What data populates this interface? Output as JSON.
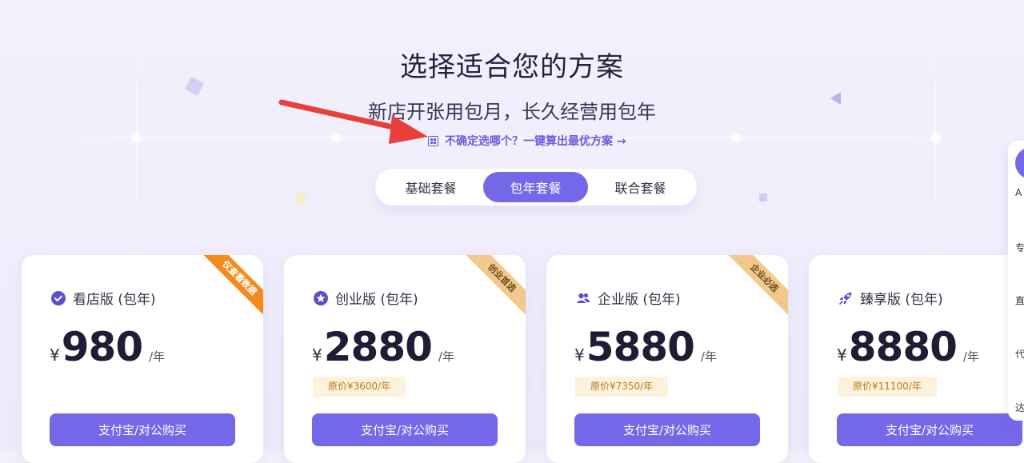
{
  "header": {
    "title": "选择适合您的方案",
    "subtitle": "新店开张用包月，长久经营用包年",
    "calc_link": "不确定选哪个？一键算出最优方案 →"
  },
  "tabs": [
    {
      "label": "基础套餐",
      "active": false
    },
    {
      "label": "包年套餐",
      "active": true
    },
    {
      "label": "联合套餐",
      "active": false
    }
  ],
  "plans": [
    {
      "name": "看店版 (包年)",
      "currency": "¥",
      "price": "980",
      "unit": "/年",
      "original_price": "",
      "ribbon": "仅查看数据",
      "button": "支付宝/对公购买",
      "icon": "check-circle-icon"
    },
    {
      "name": "创业版 (包年)",
      "currency": "¥",
      "price": "2880",
      "unit": "/年",
      "original_price": "原价¥3600/年",
      "ribbon": "创业首选",
      "button": "支付宝/对公购买",
      "icon": "star-circle-icon"
    },
    {
      "name": "企业版 (包年)",
      "currency": "¥",
      "price": "5880",
      "unit": "/年",
      "original_price": "原价¥7350/年",
      "ribbon": "企业必选",
      "button": "支付宝/对公购买",
      "icon": "users-icon"
    },
    {
      "name": "臻享版 (包年)",
      "currency": "¥",
      "price": "8880",
      "unit": "/年",
      "original_price": "原价¥11100/年",
      "ribbon": "",
      "button": "支付宝/对公购买",
      "icon": "rocket-icon"
    }
  ],
  "side_panel": {
    "items": [
      "A",
      "专",
      "直",
      "代",
      "达"
    ]
  },
  "colors": {
    "accent": "#7468e8",
    "link": "#6a5fd8",
    "ribbon_orange": "#f28c1c",
    "ribbon_peach": "#f1c98a",
    "annotation_red": "#e8403a"
  }
}
